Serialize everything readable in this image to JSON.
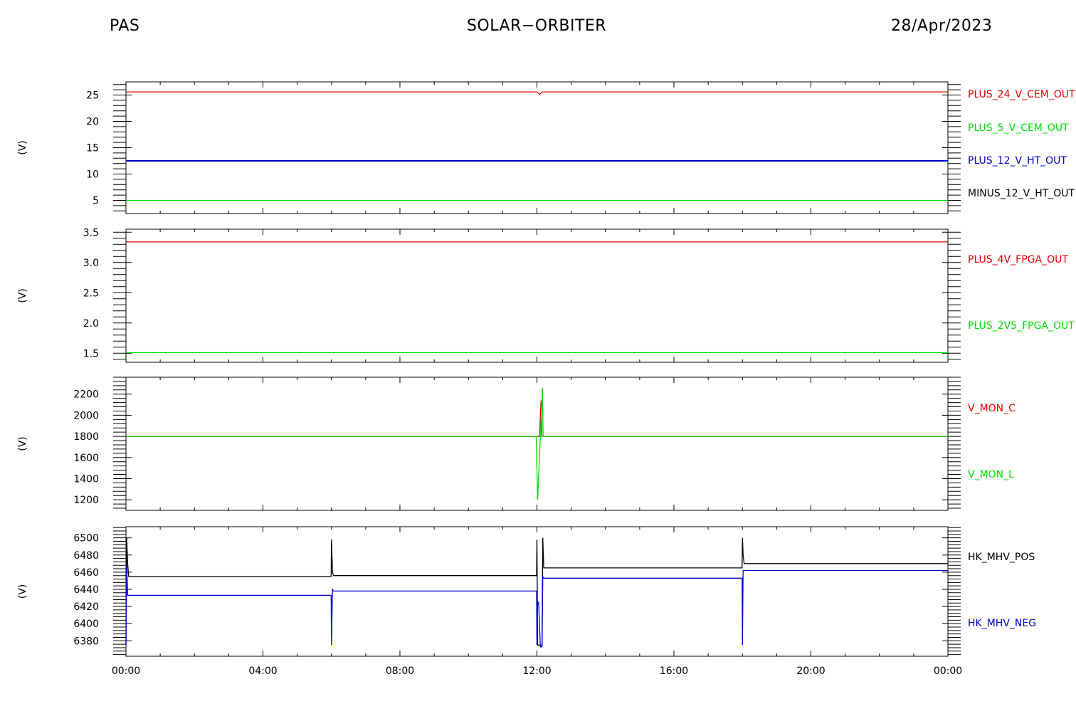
{
  "header": {
    "left": "PAS",
    "center": "SOLAR−ORBITER",
    "right": "28/Apr/2023"
  },
  "x_axis": {
    "tick_labels": [
      "00:00",
      "04:00",
      "08:00",
      "12:00",
      "16:00",
      "20:00",
      "00:00"
    ],
    "minor_per_major": 4
  },
  "colors": {
    "red": "#e00000",
    "green": "#00dd00",
    "blue": "#0000cc",
    "black": "#000000"
  },
  "chart_data": [
    {
      "type": "line",
      "ylabel": "(V)",
      "ylim": [
        2.5,
        27.5
      ],
      "yticks": [
        5,
        10,
        15,
        20,
        25
      ],
      "ytick_labels": [
        "5",
        "10",
        "15",
        "20",
        "25"
      ],
      "legend": [
        {
          "name": "PLUS_24_V_CEM_OUT",
          "color": "red"
        },
        {
          "name": "PLUS_5_V_CEM_OUT",
          "color": "green"
        },
        {
          "name": "PLUS_12_V_HT_OUT",
          "color": "blue"
        },
        {
          "name": "MINUS_12_V_HT_OUT",
          "color": "black"
        }
      ],
      "series": [
        {
          "name": "PLUS_24_V_CEM_OUT",
          "color": "red",
          "x": [
            0,
            12.0,
            12.08,
            12.15,
            24
          ],
          "y": [
            25.6,
            25.6,
            25.1,
            25.6,
            25.6
          ]
        },
        {
          "name": "PLUS_5_V_CEM_OUT",
          "color": "green",
          "x": [
            0,
            24
          ],
          "y": [
            5.0,
            5.0
          ]
        },
        {
          "name": "PLUS_12_V_HT_OUT",
          "color": "blue",
          "x": [
            0,
            24
          ],
          "y": [
            12.5,
            12.5
          ]
        }
      ]
    },
    {
      "type": "line",
      "ylabel": "(V)",
      "ylim": [
        1.35,
        3.55
      ],
      "yticks": [
        1.5,
        2.0,
        2.5,
        3.0,
        3.5
      ],
      "ytick_labels": [
        "1.5",
        "2.0",
        "2.5",
        "3.0",
        "3.5"
      ],
      "legend": [
        {
          "name": "PLUS_4V_FPGA_OUT",
          "color": "red"
        },
        {
          "name": "PLUS_2V5_FPGA_OUT",
          "color": "green"
        }
      ],
      "series": [
        {
          "name": "PLUS_4V_FPGA_OUT",
          "color": "red",
          "x": [
            0,
            24
          ],
          "y": [
            3.34,
            3.34
          ]
        },
        {
          "name": "PLUS_2V5_FPGA_OUT",
          "color": "green",
          "x": [
            0,
            24
          ],
          "y": [
            1.51,
            1.51
          ]
        }
      ]
    },
    {
      "type": "line",
      "ylabel": "(V)",
      "ylim": [
        1100,
        2360
      ],
      "yticks": [
        1200,
        1400,
        1600,
        1800,
        2000,
        2200
      ],
      "ytick_labels": [
        "1200",
        "1400",
        "1600",
        "1800",
        "2000",
        "2200"
      ],
      "legend": [
        {
          "name": "V_MON_C",
          "color": "red"
        },
        {
          "name": "V_MON_L",
          "color": "green"
        }
      ],
      "series": [
        {
          "name": "V_MON_C",
          "color": "red",
          "x": [
            0,
            12.0,
            12.08,
            12.1,
            12.12,
            12.14,
            24
          ],
          "y": [
            1800,
            1800,
            1800,
            2000,
            2140,
            1800,
            1800
          ]
        },
        {
          "name": "V_MON_L",
          "color": "green",
          "x": [
            0,
            11.98,
            12.02,
            12.06,
            12.1,
            12.14,
            12.16,
            12.18,
            12.2,
            24
          ],
          "y": [
            1800,
            1800,
            1200,
            1500,
            1800,
            2100,
            2260,
            1800,
            1800,
            1800
          ]
        }
      ]
    },
    {
      "type": "line",
      "ylabel": "(V)",
      "ylim": [
        6362,
        6513
      ],
      "yticks": [
        6380,
        6400,
        6420,
        6440,
        6460,
        6480,
        6500
      ],
      "ytick_labels": [
        "6380",
        "6400",
        "6420",
        "6440",
        "6460",
        "6480",
        "6500"
      ],
      "legend": [
        {
          "name": "HK_MHV_POS",
          "color": "black"
        },
        {
          "name": "HK_MHV_NEG",
          "color": "blue"
        }
      ],
      "series": [
        {
          "name": "HK_MHV_POS",
          "color": "black",
          "x": [
            0,
            0.02,
            0.05,
            0.08,
            5.99,
            6.0,
            6.03,
            6.06,
            11.99,
            12.0,
            12.02,
            12.05,
            12.1,
            12.15,
            12.17,
            12.2,
            12.22,
            17.99,
            18.0,
            18.02,
            18.05,
            24
          ],
          "y": [
            6375,
            6500,
            6470,
            6455,
            6455,
            6498,
            6460,
            6456,
            6456,
            6498,
            6375,
            6375,
            6375,
            6375,
            6500,
            6465,
            6465,
            6465,
            6500,
            6480,
            6470,
            6470
          ]
        },
        {
          "name": "HK_MHV_NEG",
          "color": "blue",
          "x": [
            0,
            0.02,
            0.05,
            0.08,
            5.99,
            6.0,
            6.03,
            6.06,
            11.99,
            12.0,
            12.02,
            12.05,
            12.1,
            12.15,
            12.17,
            12.2,
            12.22,
            17.99,
            18.0,
            18.02,
            18.05,
            24
          ],
          "y": [
            6375,
            6470,
            6433,
            6433,
            6433,
            6375,
            6440,
            6438,
            6438,
            6375,
            6425,
            6425,
            6373,
            6373,
            6455,
            6453,
            6453,
            6453,
            6375,
            6462,
            6462,
            6462
          ]
        }
      ]
    }
  ]
}
